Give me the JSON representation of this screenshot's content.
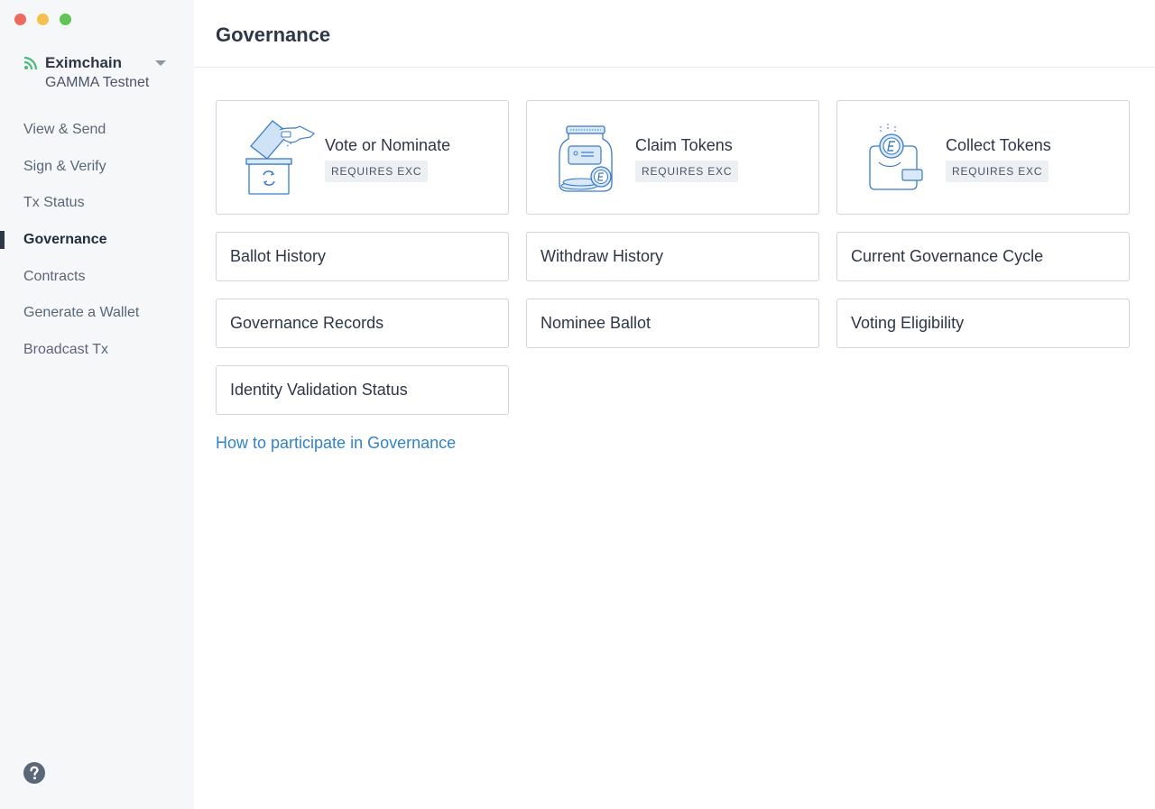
{
  "network": {
    "name": "Eximchain",
    "subtitle": "GAMMA Testnet"
  },
  "nav": {
    "items": [
      {
        "label": "View & Send"
      },
      {
        "label": "Sign & Verify"
      },
      {
        "label": "Tx Status"
      },
      {
        "label": "Governance",
        "active": true
      },
      {
        "label": "Contracts"
      },
      {
        "label": "Generate a Wallet"
      },
      {
        "label": "Broadcast Tx"
      }
    ]
  },
  "page": {
    "title": "Governance"
  },
  "actions": [
    {
      "title": "Vote or Nominate",
      "badge": "REQUIRES EXC",
      "icon": "ballot-box-icon"
    },
    {
      "title": "Claim Tokens",
      "badge": "REQUIRES EXC",
      "icon": "token-jar-icon"
    },
    {
      "title": "Collect Tokens",
      "badge": "REQUIRES EXC",
      "icon": "wallet-coin-icon"
    }
  ],
  "links": [
    {
      "label": "Ballot History"
    },
    {
      "label": "Withdraw History"
    },
    {
      "label": "Current Governance Cycle"
    },
    {
      "label": "Governance Records"
    },
    {
      "label": "Nominee Ballot"
    },
    {
      "label": "Voting Eligibility"
    },
    {
      "label": "Identity Validation Status"
    }
  ],
  "help_link": "How to participate in Governance",
  "colors": {
    "accent": "#3182ce",
    "icon_stroke": "#3a7bc8",
    "icon_fill": "#d9e9f8",
    "rss": "#48bb78"
  }
}
